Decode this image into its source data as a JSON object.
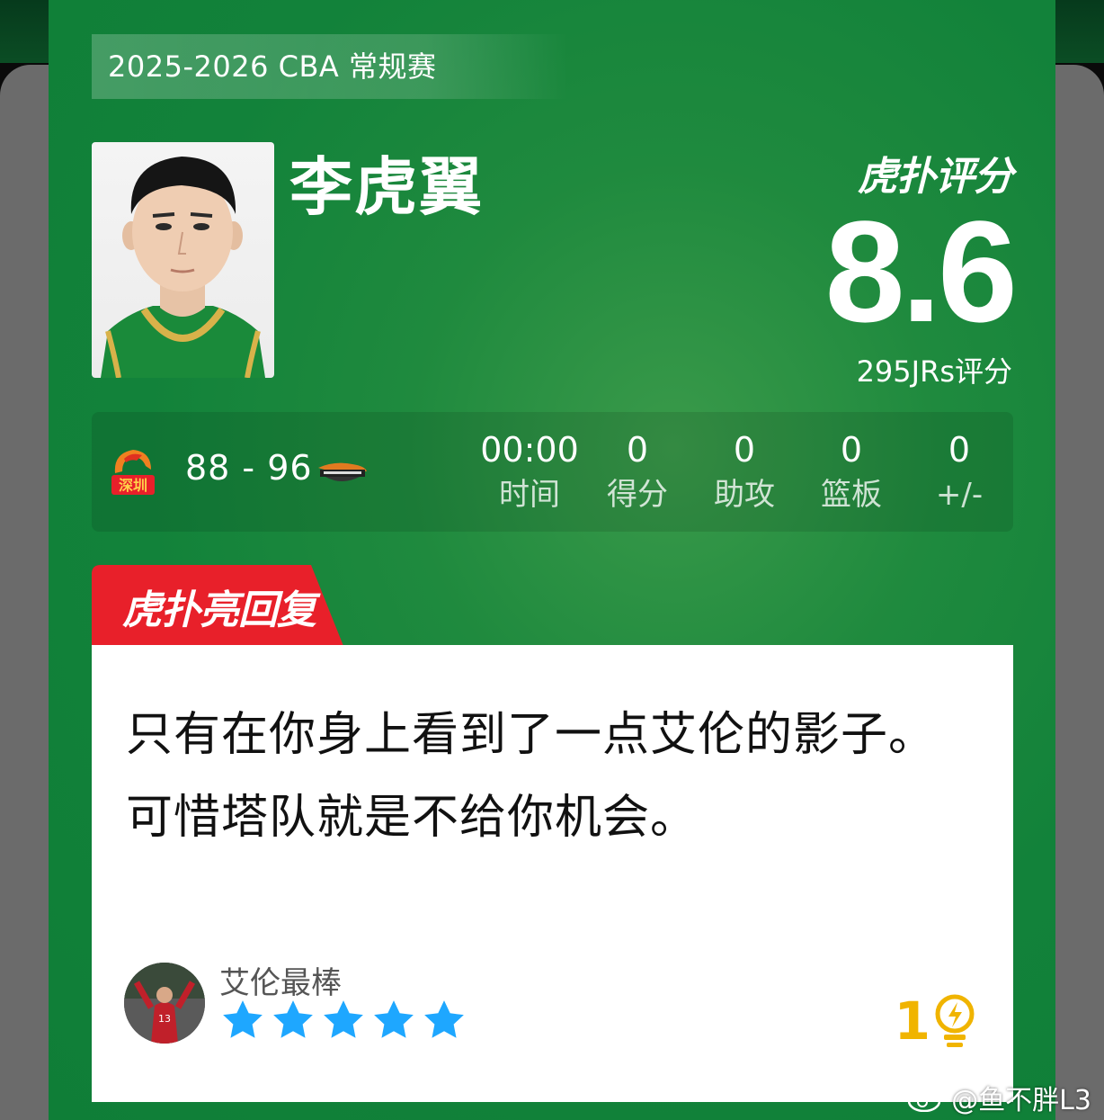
{
  "header": {
    "season_label": "2025-2026 CBA 常规赛"
  },
  "player": {
    "name": "李虎翼"
  },
  "rating": {
    "brand": "虎扑评分",
    "score": "8.6",
    "count_label": "295JRs评分"
  },
  "game": {
    "home_team_label": "深圳",
    "score": "88 - 96",
    "stats": [
      {
        "value": "00:00",
        "label": "时间"
      },
      {
        "value": "0",
        "label": "得分"
      },
      {
        "value": "0",
        "label": "助攻"
      },
      {
        "value": "0",
        "label": "篮板"
      },
      {
        "value": "0",
        "label": "+/-"
      }
    ]
  },
  "reply": {
    "tab_title": "虎扑亮回复",
    "text": "只有在你身上看到了一点艾伦的影子。可惜塔队就是不给你机会。",
    "user_name": "艾伦最棒",
    "star_count": 5,
    "like_count": "1"
  },
  "watermark": {
    "text": "@鱼不胖L3"
  },
  "colors": {
    "card_green": "#12823a",
    "reply_red": "#e8202a",
    "star_blue": "#1ea7ff",
    "like_gold": "#f0b400"
  }
}
